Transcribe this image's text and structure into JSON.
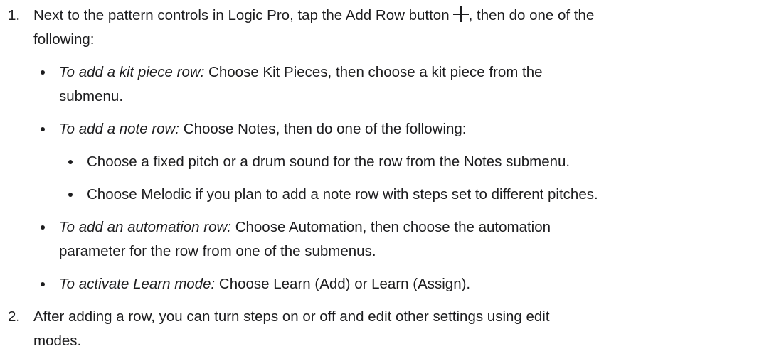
{
  "steps": [
    {
      "number": "1.",
      "text_before_icon": "Next to the pattern controls in Logic Pro, tap the Add Row button",
      "icon": "plus-icon",
      "text_after_icon_line1": ", then do one of the",
      "text_line2": "following:"
    },
    {
      "number": "2.",
      "text_line1": "After adding a row, you can turn steps on or off and edit other settings using edit",
      "text_line2": "modes."
    }
  ],
  "bullets": [
    {
      "lead": "To add a kit piece row:",
      "line1": " Choose Kit Pieces, then choose a kit piece from the",
      "line2": "submenu."
    },
    {
      "lead": "To add a note row:",
      "line1": " Choose Notes, then do one of the following:"
    },
    {
      "lead": "To add an automation row:",
      "line1": " Choose Automation, then choose the automation",
      "line2": "parameter for the row from one of the submenus."
    },
    {
      "lead": "To activate Learn mode:",
      "line1": " Choose Learn (Add) or Learn (Assign)."
    }
  ],
  "sub_bullets": [
    "Choose a fixed pitch or a drum sound for the row from the Notes submenu.",
    "Choose Melodic if you plan to add a note row with steps set to different pitches."
  ]
}
